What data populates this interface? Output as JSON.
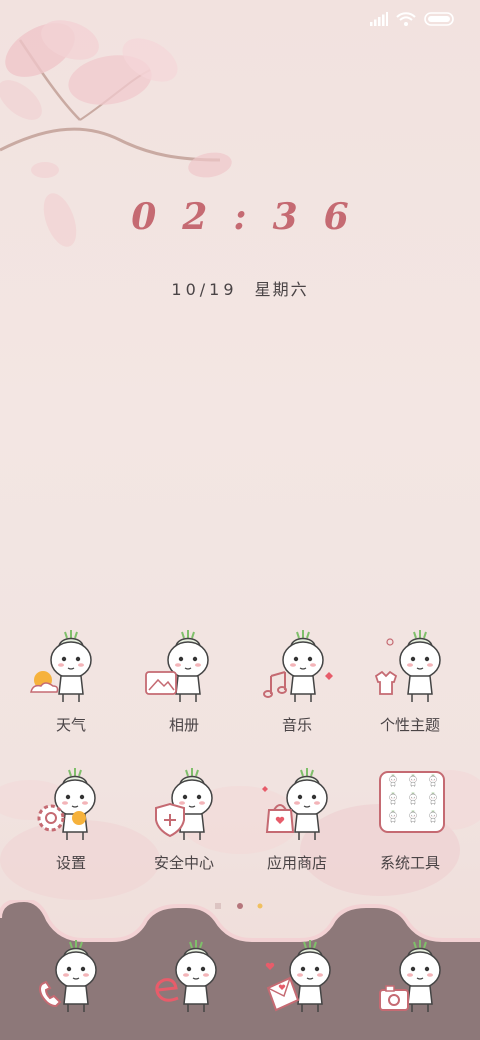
{
  "status_bar": {
    "icons": [
      "signal-icon",
      "wifi-icon",
      "battery-icon"
    ]
  },
  "clock": {
    "time": "02:36",
    "date": "10/19",
    "weekday": "星期六"
  },
  "apps": [
    {
      "name": "weather",
      "label": "天气",
      "icon": "weather-icon"
    },
    {
      "name": "gallery",
      "label": "相册",
      "icon": "gallery-icon"
    },
    {
      "name": "music",
      "label": "音乐",
      "icon": "music-icon"
    },
    {
      "name": "themes",
      "label": "个性主题",
      "icon": "theme-icon"
    },
    {
      "name": "settings",
      "label": "设置",
      "icon": "settings-icon"
    },
    {
      "name": "security",
      "label": "安全中心",
      "icon": "security-icon"
    },
    {
      "name": "app-store",
      "label": "应用商店",
      "icon": "store-icon"
    },
    {
      "name": "system-tools",
      "label": "系统工具",
      "icon": "folder-icon"
    }
  ],
  "page_indicator": {
    "pages": 3,
    "current": 1
  },
  "dock": [
    {
      "name": "phone",
      "icon": "phone-icon"
    },
    {
      "name": "browser",
      "icon": "browser-icon"
    },
    {
      "name": "messages",
      "icon": "messages-icon"
    },
    {
      "name": "camera",
      "icon": "camera-icon"
    }
  ],
  "colors": {
    "accent": "#c56a72",
    "dock": "#8a7576",
    "wallpaper": "#f2e4e1",
    "text": "#4a4446"
  }
}
